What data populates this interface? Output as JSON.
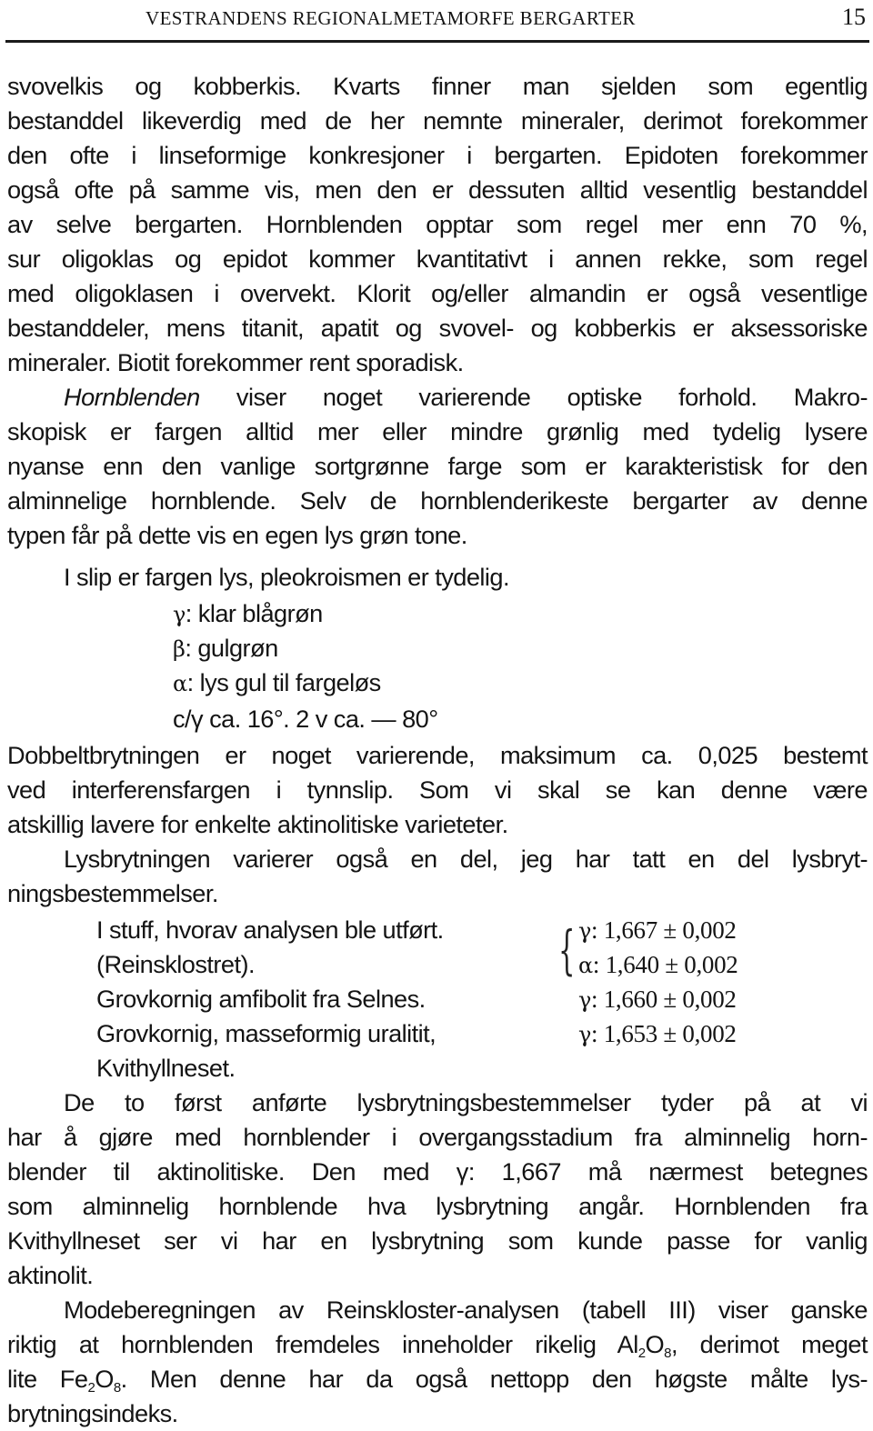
{
  "header": {
    "running_title": "VESTRANDENS REGIONALMETAMORFE BERGARTER",
    "page_number": "15"
  },
  "body": {
    "p1": [
      "svovelkis og kobberkis. Kvarts finner man sjelden som egentlig",
      "bestanddel likeverdig med de her nemnte mineraler, derimot forekommer",
      "den ofte i linseformige konkresjoner i bergarten. Epidoten forekommer",
      "også ofte på samme vis, men den er dessuten alltid vesentlig bestanddel",
      "av selve bergarten. Hornblenden opptar som regel mer enn 70 %,",
      "sur oligoklas og epidot kommer kvantitativt i annen rekke, som regel",
      "med oligoklasen i overvekt. Klorit og/eller almandin er også vesentlige",
      "bestanddeler, mens titanit, apatit og svovel- og kobberkis er aksessoriske",
      "mineraler. Biotit forekommer rent sporadisk."
    ],
    "p2_italic_lead": "Hornblenden",
    "p2_first_rest": " viser noget varierende optiske forhold. Makro-",
    "p2": [
      "skopisk er fargen alltid mer eller mindre grønlig med tydelig lysere",
      "nyanse enn den vanlige sortgrønne farge som er karakteristisk for den",
      "alminnelige hornblende. Selv de hornblenderikeste bergarter av denne",
      "typen får på dette vis en egen lys grøn tone."
    ],
    "p3": "I slip er fargen lys, pleokroismen er tydelig.",
    "pleochroism": [
      {
        "symbol": "γ",
        "text": ": klar blågrøn"
      },
      {
        "symbol": "β",
        "text": ": gulgrøn"
      },
      {
        "symbol": "α",
        "text": ": lys gul til fargeløs"
      }
    ],
    "extinction": "c/γ ca. 16°.  2 v ca. — 80°",
    "p4": [
      "Dobbeltbrytningen er noget varierende, maksimum ca. 0,025 bestemt",
      "ved interferensfargen i tynnslip. Som vi skal se kan denne være",
      "atskillig lavere for enkelte aktinolitiske varieteter."
    ],
    "p5": [
      "Lysbrytningen varierer også en del, jeg har tatt en del lysbryt-",
      "ningsbestemmelser."
    ],
    "measurements": {
      "labels": [
        "I stuff, hvorav analysen ble utført.",
        "(Reinsklostret).",
        "Grovkornig amfibolit fra Selnes.",
        "Grovkornig, masseformig uralitit,",
        "Kvithyllneset."
      ],
      "values": [
        {
          "symbol": "γ",
          "value": ": 1,667 ± 0,002"
        },
        {
          "symbol": "α",
          "value": ": 1,640 ± 0,002"
        },
        {
          "symbol": "γ",
          "value": ": 1,660 ± 0,002"
        },
        {
          "symbol": "γ",
          "value": ": 1,653 ± 0,002"
        }
      ]
    },
    "p6": [
      "De to først anførte lysbrytningsbestemmelser tyder på at vi",
      "har å gjøre med hornblender i overgangsstadium fra alminnelig horn-",
      "blender til aktinolitiske. Den med γ: 1,667 må nærmest betegnes",
      "som alminnelig hornblende hva lysbrytning angår. Hornblenden fra",
      "Kvithyllneset ser vi har en lysbrytning som kunde passe for vanlig",
      "aktinolit."
    ],
    "p7": {
      "l1": "Modeberegningen av Reinskloster-analysen (tabell III) viser ganske",
      "l2_a": "riktig at hornblenden fremdeles inneholder rikelig Al",
      "l2_sub1": "2",
      "l2_b": "O",
      "l2_sub2": "8",
      "l2_c": ", derimot meget",
      "l3_a": "lite Fe",
      "l3_sub1": "2",
      "l3_b": "O",
      "l3_sub2": "8",
      "l3_c": ".  Men denne har da også nettopp den høgste målte lys-",
      "l4": "brytningsindeks."
    }
  }
}
